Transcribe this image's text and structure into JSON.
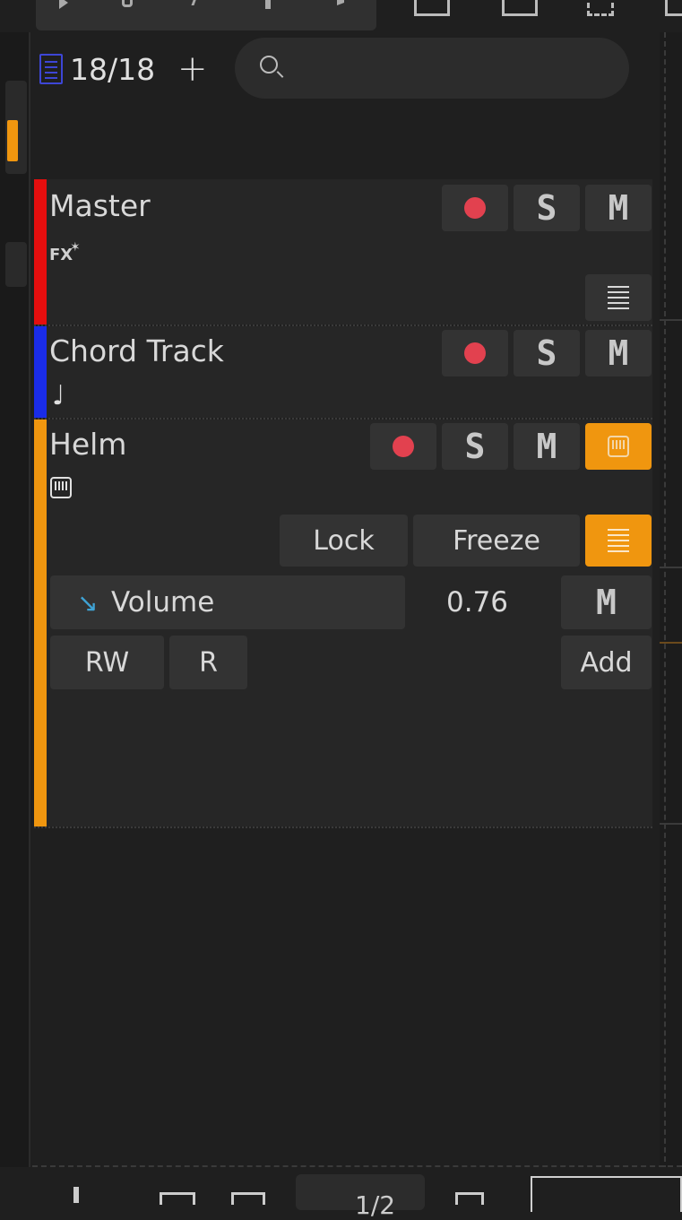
{
  "colors": {
    "background": "#1f1f1f",
    "panel": "#262626",
    "button": "#333333",
    "accent": "#f0960f",
    "record": "#e2414f",
    "master_color": "#e50e0e",
    "chord_color": "#1a2ce8",
    "helm_color": "#f0960f",
    "automation_icon": "#3fa4d6"
  },
  "header": {
    "track_count": "18/18",
    "add_symbol": "+",
    "search_placeholder": ""
  },
  "tracks": [
    {
      "name": "Master",
      "sub_icon": "fx-icon",
      "sub_text": "FX",
      "buttons": {
        "record": "",
        "solo": "S",
        "mute": "M"
      }
    },
    {
      "name": "Chord Track",
      "sub_icon": "music-note-icon",
      "buttons": {
        "record": "",
        "solo": "S",
        "mute": "M"
      }
    },
    {
      "name": "Helm",
      "sub_icon": "piano-icon",
      "buttons": {
        "record": "",
        "solo": "S",
        "mute": "M"
      },
      "actions": {
        "lock": "Lock",
        "freeze": "Freeze"
      },
      "automation": {
        "label": "Volume",
        "value": "0.76",
        "mute": "M",
        "rw": "RW",
        "r": "R",
        "add": "Add"
      }
    }
  ],
  "footer": {
    "page": "1/2"
  }
}
